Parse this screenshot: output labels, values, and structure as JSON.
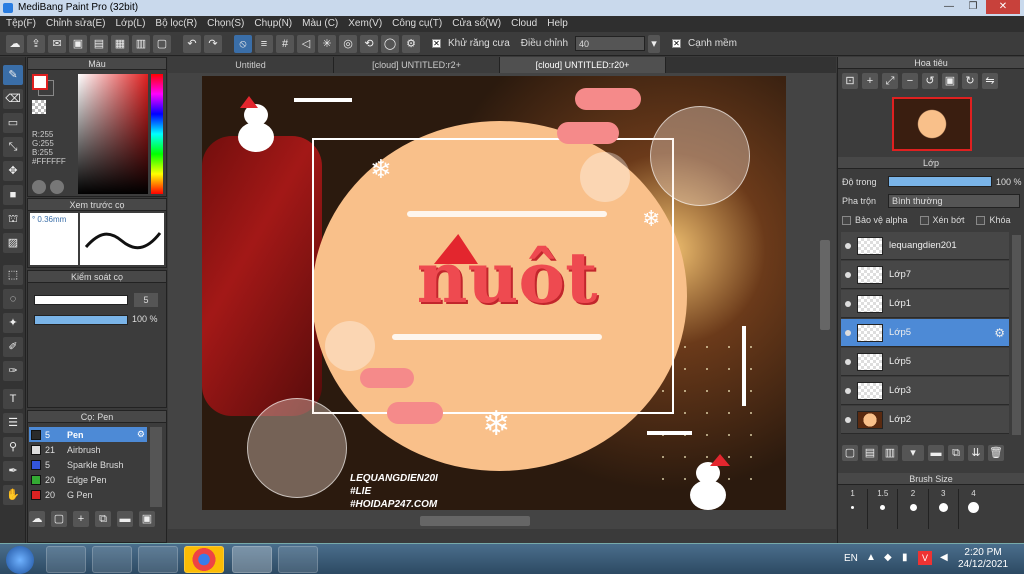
{
  "window": {
    "title": "MediBang Paint Pro (32bit)",
    "minimize": "—",
    "restore": "❐",
    "close": "✕"
  },
  "menu": [
    "Tệp(F)",
    "Chỉnh sửa(E)",
    "Lớp(L)",
    "Bộ lọc(R)",
    "Chọn(S)",
    "Chụp(N)",
    "Màu (C)",
    "Xem(V)",
    "Công cụ(T)",
    "Cửa sổ(W)",
    "Cloud",
    "Help"
  ],
  "toolbar": {
    "antialias_label": "Khử răng cưa",
    "adjust_label": "Điều chỉnh",
    "adjust_value": "40",
    "soft_edge_label": "Cạnh mềm"
  },
  "color_panel": {
    "title": "Màu",
    "r": "R:255",
    "g": "G:255",
    "b": "B:255",
    "hex": "#FFFFFF",
    "foreground": "#ffffff",
    "background": "#e02020"
  },
  "brush_preview": {
    "title": "Xem trước cọ",
    "size_label": "° 0.36mm"
  },
  "brush_control": {
    "title": "Kiểm soát cọ",
    "size": "5",
    "opacity": "100 %"
  },
  "brush_list": {
    "title": "Cọ: Pen",
    "items": [
      {
        "size": "5",
        "name": "Pen",
        "color": "#2a2a2a"
      },
      {
        "size": "21",
        "name": "Airbrush",
        "color": "#dddddd"
      },
      {
        "size": "5",
        "name": "Sparkle Brush",
        "color": "#3355dd"
      },
      {
        "size": "20",
        "name": "Edge Pen",
        "color": "#33aa33"
      },
      {
        "size": "20",
        "name": "G Pen",
        "color": "#dd2222"
      }
    ]
  },
  "tabs": [
    "Untitled",
    "[cloud] UNTITLED:r2+",
    "[cloud] UNTITLED:r20+"
  ],
  "artwork": {
    "title_text": "nuôt",
    "watermark_lines": [
      "LEQUANGDIEN20I",
      "#LIE",
      "#HOIDAP247.COM"
    ]
  },
  "navigator": {
    "title": "Hoa tiêu"
  },
  "layer_panel": {
    "title": "Lớp",
    "opacity_label": "Độ trong",
    "opacity_value": "100 %",
    "opacity_level": 100,
    "blend_label": "Pha trộn",
    "blend_value": "Bình thường",
    "protect_alpha": "Bảo vệ alpha",
    "clipping": "Xén bớt",
    "lock": "Khóa",
    "layers": [
      "lequangdien201",
      "Lớp7",
      "Lớp1",
      "Lớp5",
      "Lớp5",
      "Lớp3",
      "Lớp2"
    ],
    "selected_index": 3
  },
  "brush_size_panel": {
    "title": "Brush Size",
    "sizes": [
      "1",
      "1.5",
      "2",
      "3",
      "4"
    ]
  },
  "taskbar": {
    "lang": "EN",
    "time": "2:20 PM",
    "date": "24/12/2021"
  }
}
